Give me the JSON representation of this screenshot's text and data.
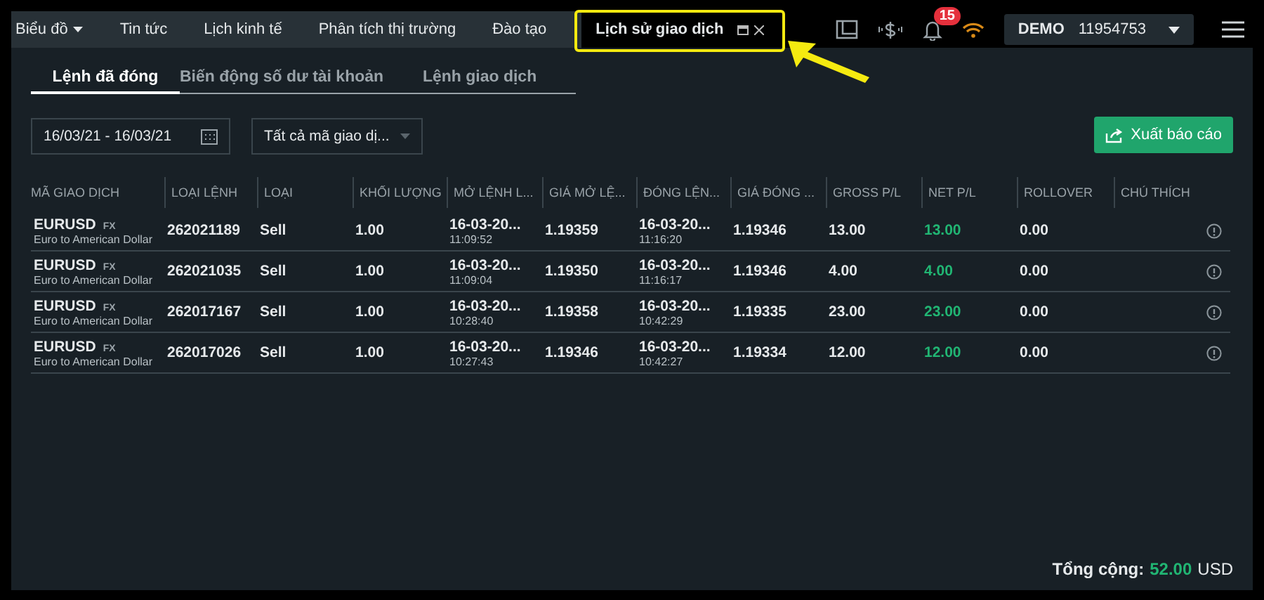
{
  "nav": {
    "tabs": [
      {
        "label": "Biểu đồ",
        "selected": false,
        "kind": "dropdown"
      },
      {
        "label": "Tin tức",
        "selected": false,
        "kind": "plain"
      },
      {
        "label": "Lịch kinh tế",
        "selected": false,
        "kind": "plain"
      },
      {
        "label": "Phân tích thị trường",
        "selected": false,
        "kind": "plain"
      },
      {
        "label": "Đào tạo",
        "selected": false,
        "kind": "plain"
      },
      {
        "label": "Lịch sử giao dịch",
        "selected": true,
        "kind": "closable"
      }
    ],
    "notification_count": "15",
    "account": {
      "mode": "DEMO",
      "number": "11954753"
    }
  },
  "subtabs": [
    {
      "label": "Lệnh đã đóng",
      "selected": true
    },
    {
      "label": "Biến động số dư tài khoản",
      "selected": false
    },
    {
      "label": "Lệnh giao dịch",
      "selected": false
    }
  ],
  "filters": {
    "date_range": "16/03/21 - 16/03/21",
    "symbol": "Tất cả mã giao dị..."
  },
  "export_button": "Xuất báo cáo",
  "table": {
    "columns": [
      "MÃ GIAO DỊCH",
      "LOẠI LỆNH",
      "LOẠI",
      "KHỐI LƯỢNG",
      "MỞ LỆNH L...",
      "GIÁ MỞ LỆ...",
      "ĐÓNG LỆN...",
      "GIÁ ĐÓNG ...",
      "GROSS P/L",
      "NET P/L",
      "ROLLOVER",
      "CHÚ THÍCH"
    ],
    "rows": [
      {
        "symbol": "EURUSD",
        "tag": "FX",
        "desc": "Euro to American Dollar",
        "order": "262021189",
        "type": "Sell",
        "volume": "1.00",
        "open_date": "16-03-20...",
        "open_time": "11:09:52",
        "open_price": "1.19359",
        "close_date": "16-03-20...",
        "close_time": "11:16:20",
        "close_price": "1.19346",
        "gross": "13.00",
        "net": "13.00",
        "rollover": "0.00"
      },
      {
        "symbol": "EURUSD",
        "tag": "FX",
        "desc": "Euro to American Dollar",
        "order": "262021035",
        "type": "Sell",
        "volume": "1.00",
        "open_date": "16-03-20...",
        "open_time": "11:09:04",
        "open_price": "1.19350",
        "close_date": "16-03-20...",
        "close_time": "11:16:17",
        "close_price": "1.19346",
        "gross": "4.00",
        "net": "4.00",
        "rollover": "0.00"
      },
      {
        "symbol": "EURUSD",
        "tag": "FX",
        "desc": "Euro to American Dollar",
        "order": "262017167",
        "type": "Sell",
        "volume": "1.00",
        "open_date": "16-03-20...",
        "open_time": "10:28:40",
        "open_price": "1.19358",
        "close_date": "16-03-20...",
        "close_time": "10:42:29",
        "close_price": "1.19335",
        "gross": "23.00",
        "net": "23.00",
        "rollover": "0.00"
      },
      {
        "symbol": "EURUSD",
        "tag": "FX",
        "desc": "Euro to American Dollar",
        "order": "262017026",
        "type": "Sell",
        "volume": "1.00",
        "open_date": "16-03-20...",
        "open_time": "10:27:43",
        "open_price": "1.19346",
        "close_date": "16-03-20...",
        "close_time": "10:42:27",
        "close_price": "1.19334",
        "gross": "12.00",
        "net": "12.00",
        "rollover": "0.00"
      }
    ]
  },
  "total": {
    "label": "Tổng cộng:",
    "value": "52.00",
    "currency": "USD"
  }
}
